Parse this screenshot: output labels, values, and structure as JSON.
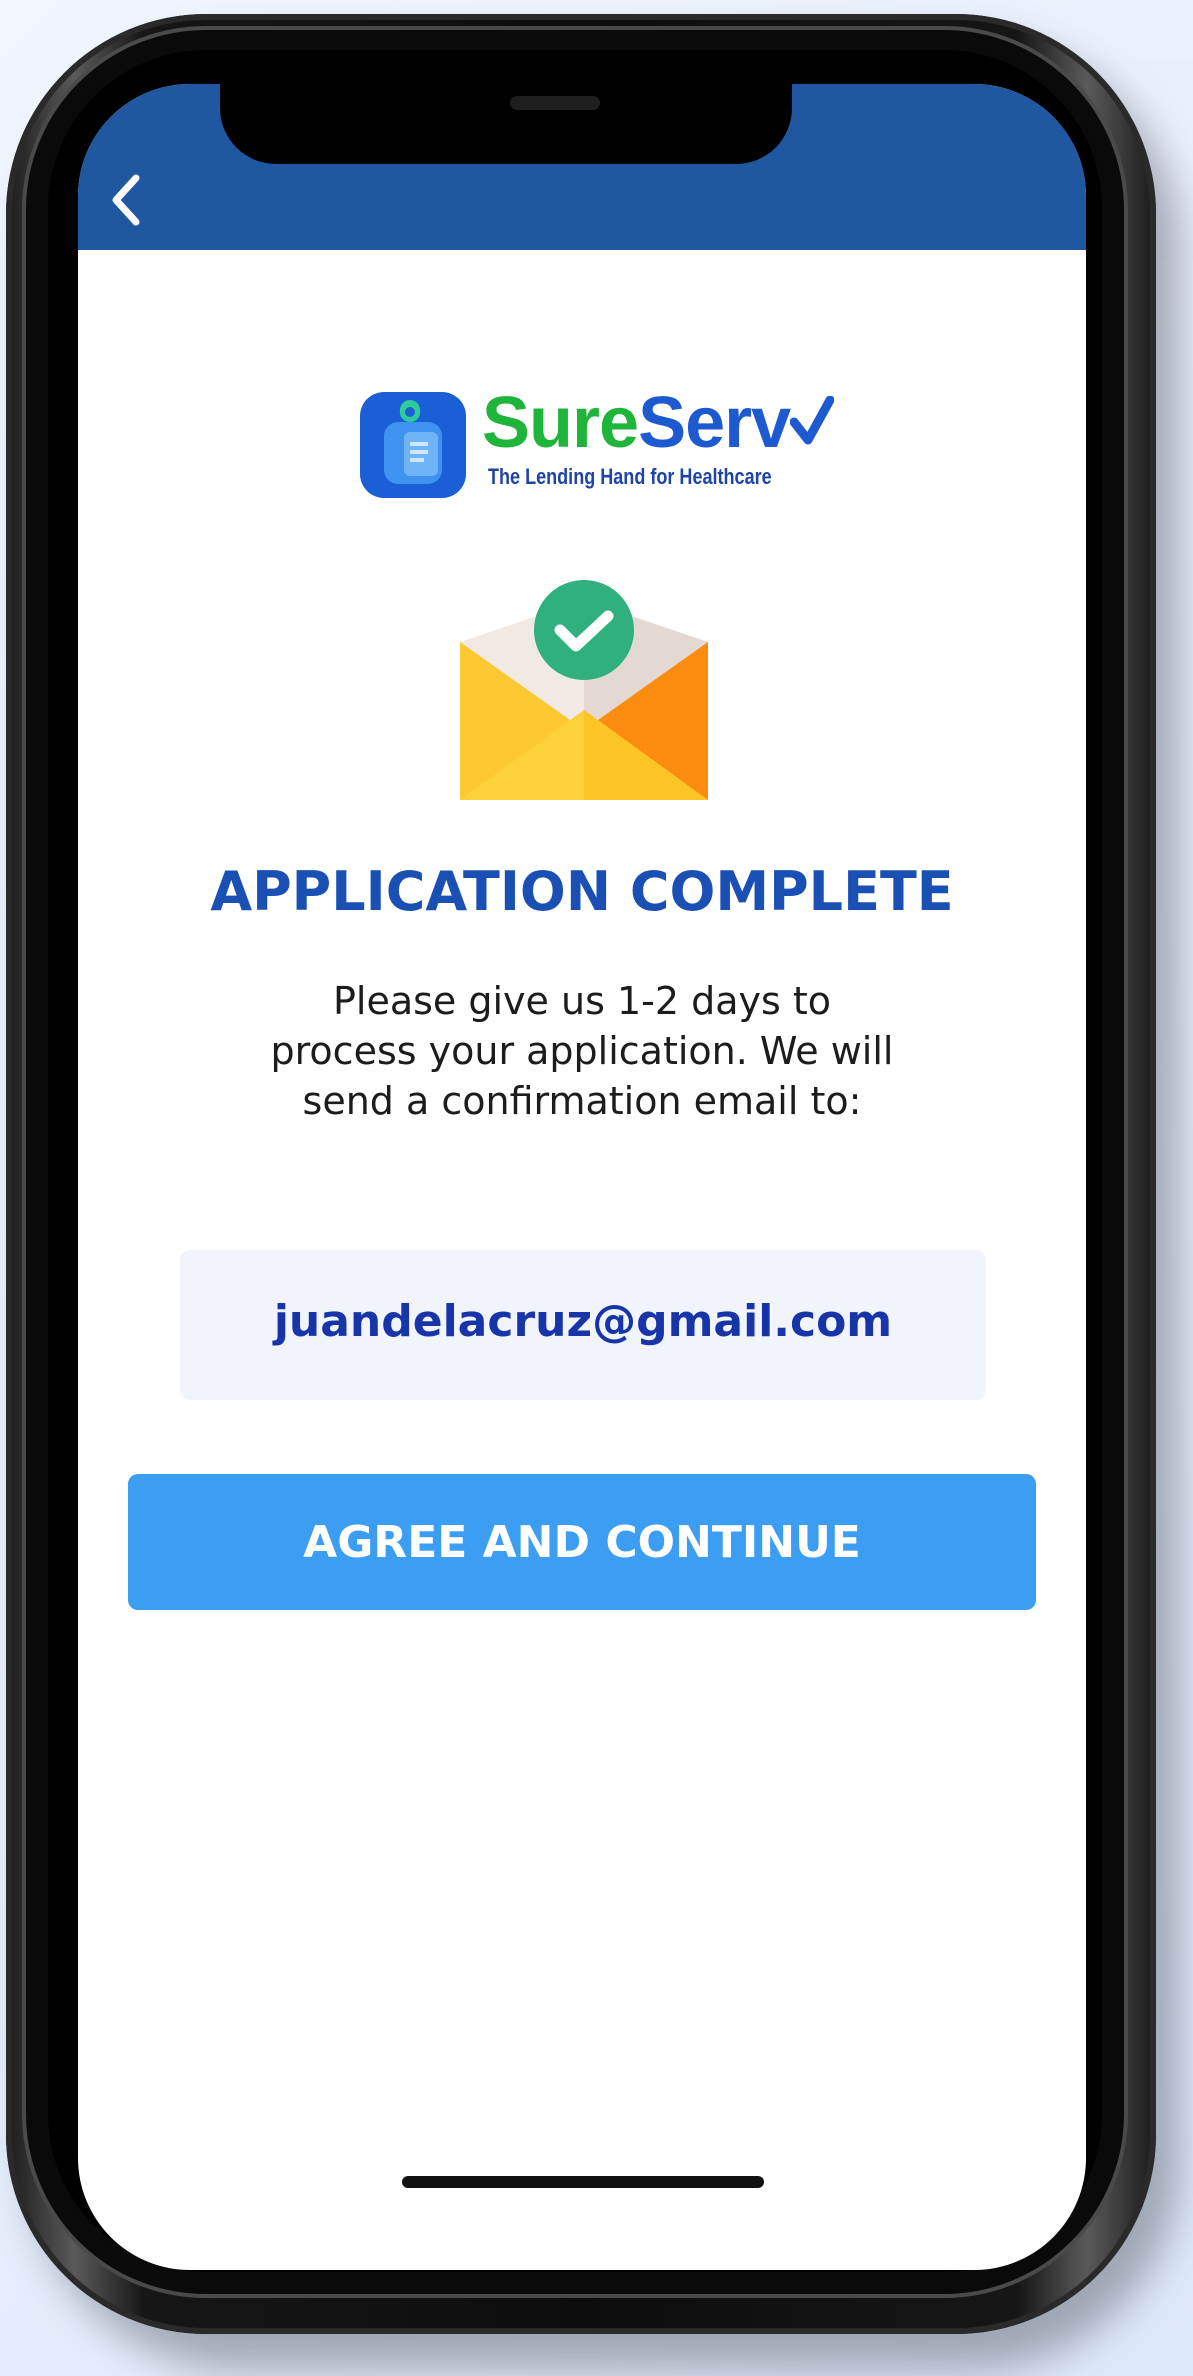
{
  "header": {
    "back_icon": "chevron-left-icon",
    "background_color": "#1f57a0"
  },
  "brand": {
    "name_part1": "Sure",
    "name_part2": "Serv",
    "tagline": "The Lending Hand for Healthcare",
    "green": "#1fb43a",
    "blue": "#1d5ad0"
  },
  "illustration": {
    "icon": "envelope-check-icon"
  },
  "main": {
    "title": "APPLICATION COMPLETE",
    "message": "Please give us 1-2 days to process your application. We will send a confirmation email to:",
    "email": "juandelacruz@gmail.com",
    "continue_label": "AGREE AND CONTINUE",
    "button_color": "#3c9ef2",
    "title_color": "#1a4fb3"
  }
}
